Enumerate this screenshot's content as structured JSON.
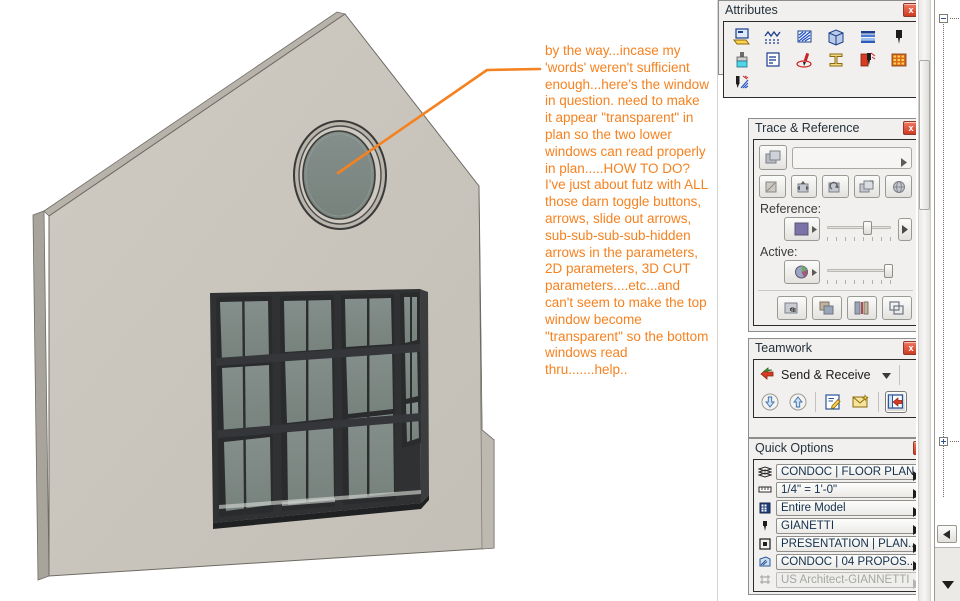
{
  "app": {
    "canvas_background": "#ffffff",
    "annotation_color": "#F58220",
    "model_wall_color": "#c9c5bc",
    "model_glass_color": "#7d8884"
  },
  "annotation": {
    "name": "leader-note",
    "text": "by the way...incase my 'words' weren't sufficient enough...here's the window in question. need to make it appear \"transparent\" in plan so the two lower windows can read properly in plan.....HOW TO DO? I've just about futz with ALL those darn toggle buttons, arrows, slide out arrows, sub-sub-sub-sub-hidden arrows in the parameters, 2D parameters, 3D CUT parameters....etc...and can't seem to make the top window become \"transparent\" so the bottom windows read thru.......help.."
  },
  "palettes": {
    "attributes": {
      "title": "Attributes",
      "close_label": "x",
      "icons": [
        {
          "name": "fill-attribute-icon",
          "label": "Fill"
        },
        {
          "name": "roof-attribute-icon",
          "label": "Roof"
        },
        {
          "name": "hatch-attribute-icon",
          "label": "Hatch"
        },
        {
          "name": "building-material-icon",
          "label": "Building Material"
        },
        {
          "name": "composite-structure-icon",
          "label": "Composite"
        },
        {
          "name": "pen-weight-icon",
          "label": "Pen"
        },
        {
          "name": "surface-paint-icon",
          "label": "Surface"
        },
        {
          "name": "line-type-icon",
          "label": "Line Type"
        },
        {
          "name": "marker-attribute-icon",
          "label": "Marker"
        },
        {
          "name": "profile-manager-icon",
          "label": "Profile Manager"
        },
        {
          "name": "zone-category-icon",
          "label": "Zone Category"
        },
        {
          "name": "city-grid-icon",
          "label": "City"
        },
        {
          "name": "operation-profile-icon",
          "label": "Operation Profile"
        }
      ]
    },
    "trace": {
      "title": "Trace & Reference",
      "close_label": "x",
      "field_value": "",
      "field_arrow": "▶",
      "reference_label": "Reference:",
      "active_label": "Active:",
      "reference_slider_percent": 68,
      "active_slider_percent": 96,
      "buttons": [
        {
          "name": "choose-reference-button"
        },
        {
          "name": "rotate-reference-button"
        },
        {
          "name": "move-reference-button"
        },
        {
          "name": "reset-reference-button"
        },
        {
          "name": "align-reference-button"
        },
        {
          "name": "reference-globe-button"
        },
        {
          "name": "pan-trace-button"
        },
        {
          "name": "swap-reference-button"
        },
        {
          "name": "split-view-button"
        },
        {
          "name": "overlay-view-button"
        }
      ]
    },
    "teamwork": {
      "title": "Teamwork",
      "close_label": "x",
      "send_receive_label": "Send & Receive",
      "caret": "▼",
      "buttons": [
        {
          "name": "receive-changes-button",
          "label": "Receive"
        },
        {
          "name": "send-changes-button",
          "label": "Send"
        },
        {
          "name": "reserve-elements-button",
          "label": "Reserve"
        },
        {
          "name": "messages-button",
          "label": "Messages"
        },
        {
          "name": "teamwork-project-button",
          "label": "Project"
        }
      ]
    },
    "quick_options": {
      "title": "Quick Options",
      "close_label": "x",
      "rows": [
        {
          "icon": "layer-combination-icon",
          "value": "CONDOC | FLOOR PLAN",
          "arrow": "▶",
          "disabled": false
        },
        {
          "icon": "scale-ruler-icon",
          "value": "1/4\"  =  1'-0\"",
          "arrow": "▶",
          "disabled": false
        },
        {
          "icon": "structure-display-icon",
          "value": "Entire Model",
          "arrow": "▶",
          "disabled": false
        },
        {
          "icon": "pen-set-icon",
          "value": "GIANETTI",
          "arrow": "▶",
          "disabled": false
        },
        {
          "icon": "model-view-options-icon",
          "value": "PRESENTATION | PLAN...",
          "arrow": "▶",
          "disabled": false
        },
        {
          "icon": "graphic-override-icon",
          "value": "CONDOC | 04 PROPOS...",
          "arrow": "▶",
          "disabled": false
        },
        {
          "icon": "dimension-style-icon",
          "value": "US Architect-GIANNETTI",
          "arrow": "▶",
          "disabled": true
        }
      ]
    }
  },
  "tree_panel": {
    "name": "project-tree-panel",
    "collapse_node_label": "-",
    "expand_node_label": "+",
    "scroll_left_arrow": "◀",
    "scroll_down_arrow": "▼"
  }
}
